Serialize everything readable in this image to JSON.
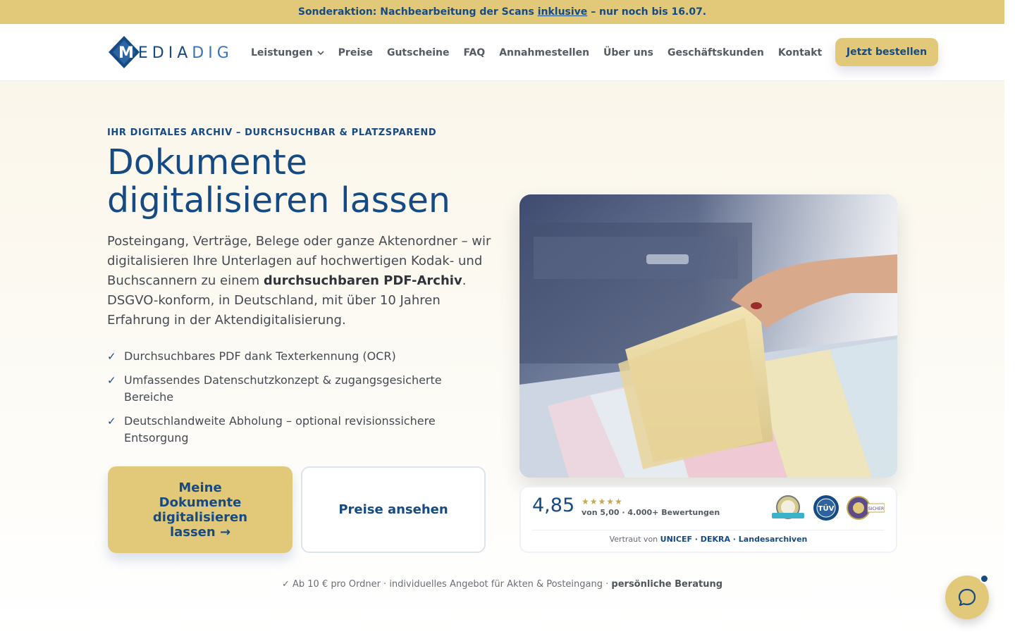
{
  "promo": {
    "prefix": "Sonderaktion: Nachbearbeitung der Scans",
    "link": "inklusive",
    "suffix": "– nur noch bis 16.07."
  },
  "logo": {
    "m": "M",
    "edia": "EDIA",
    "dig": "DIG"
  },
  "nav": {
    "items": [
      "Leistungen",
      "Preise",
      "Gutscheine",
      "FAQ",
      "Annahmestellen",
      "Über uns",
      "Geschäftskunden",
      "Kontakt"
    ],
    "cta": "Jetzt bestellen"
  },
  "hero": {
    "eyebrow": "IHR DIGITALES ARCHIV – DURCHSUCHBAR & PLATZSPAREND",
    "title": "Dokumente digitalisieren lassen",
    "lead_1": "Posteingang, Verträge, Belege oder ganze Aktenordner – wir digitalisieren Ihre Unterlagen auf hochwertigen Kodak- und Buchscannern zu einem",
    "lead_bold": "durchsuchbaren PDF-Archiv",
    "lead_2": ". DSGVO-konform, in Deutschland, mit über 10 Jahren Erfahrung in der Aktendigitalisierung.",
    "check_mark": "✓",
    "checks": [
      "Durchsuchbares PDF dank Texterkennung (OCR)",
      "Umfassendes Datenschutzkonzept & zugangsgesicherte Bereiche",
      "Deutschlandweite Abholung – optional revisionssichere Entsorgung"
    ],
    "primary_button": "Meine Dokumente digitalisieren lassen →",
    "secondary_button": "Preise ansehen"
  },
  "rating": {
    "score": "4,85",
    "stars": "★★★★★",
    "sub": "von 5,00 · 4.000+ Bewertungen",
    "trust_prefix": "Vertraut von",
    "trust_names": "UNICEF · DEKRA · Landesarchiven",
    "badge_tuv": "TÜV",
    "badge_shop": "SICHER"
  },
  "footnote": {
    "text": "✓ Ab 10 € pro Ordner · individuelles Angebot für Akten & Posteingang ·",
    "bold": "persönliche Beratung"
  },
  "colors": {
    "brand_blue": "#164a83",
    "gold": "#e2c97a",
    "hero_bg": "#fbf6ea"
  }
}
